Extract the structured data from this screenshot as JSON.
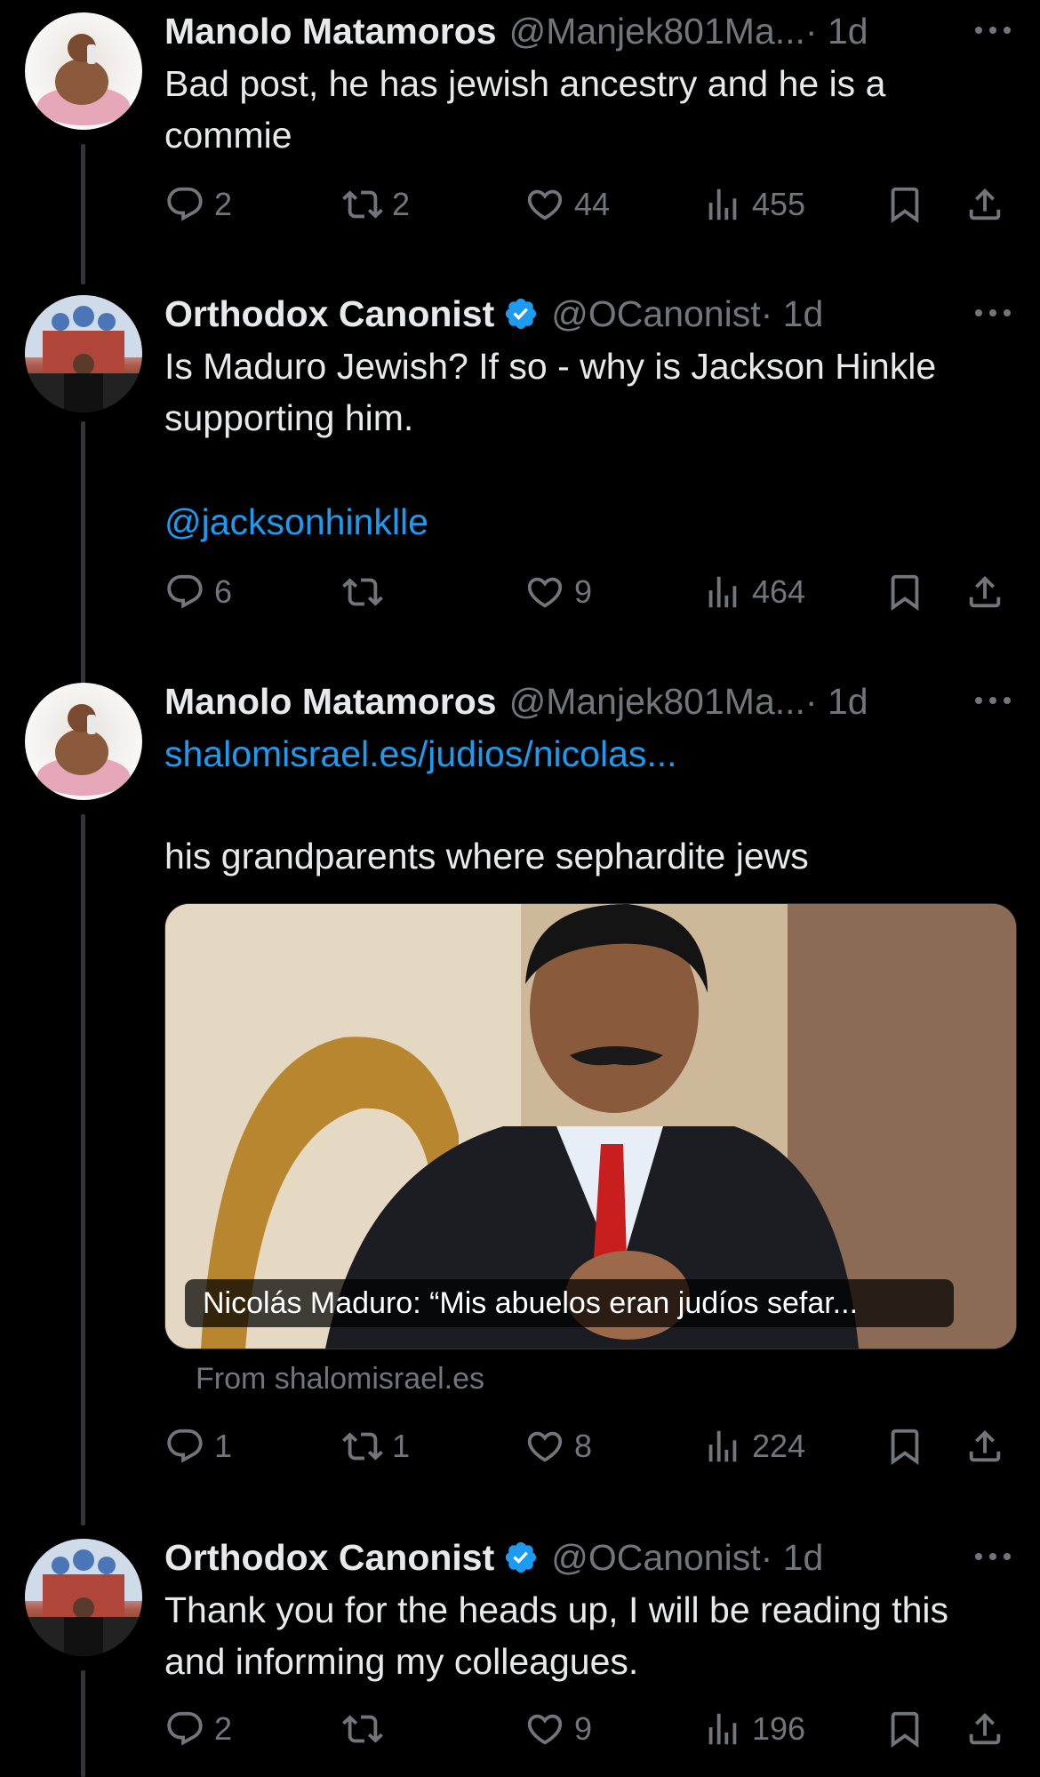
{
  "colors": {
    "background": "#000000",
    "text": "#e7e9ea",
    "muted": "#71767b",
    "link": "#1d9bf0",
    "verified": "#1d9bf0"
  },
  "tweets": [
    {
      "name": "Manolo Matamoros",
      "handle": "@Manjek801Ma...",
      "time": "· 1d",
      "verified": false,
      "text": "Bad post, he has jewish ancestry and he is a commie",
      "replies": "2",
      "reposts": "2",
      "likes": "44",
      "views": "455"
    },
    {
      "name": "Orthodox Canonist",
      "handle": "@OCanonist",
      "time": "· 1d",
      "verified": true,
      "text": "Is Maduro Jewish? If so - why is Jackson Hinkle supporting him.",
      "mention": "@jacksonhinklle",
      "replies": "6",
      "reposts": "",
      "likes": "9",
      "views": "464"
    },
    {
      "name": "Manolo Matamoros",
      "handle": "@Manjek801Ma...",
      "time": "· 1d",
      "verified": false,
      "link": "shalomisrael.es/judios/nicolas...",
      "text": "his grandparents where sephardite jews",
      "card_caption": "Nicolás Maduro: “Mis abuelos eran judíos sefar...",
      "card_source": "From shalomisrael.es",
      "replies": "1",
      "reposts": "1",
      "likes": "8",
      "views": "224"
    },
    {
      "name": "Orthodox Canonist",
      "handle": "@OCanonist",
      "time": "· 1d",
      "verified": true,
      "text": "Thank you for the heads up, I will be reading this and informing my colleagues.",
      "replies": "2",
      "reposts": "",
      "likes": "9",
      "views": "196"
    }
  ]
}
